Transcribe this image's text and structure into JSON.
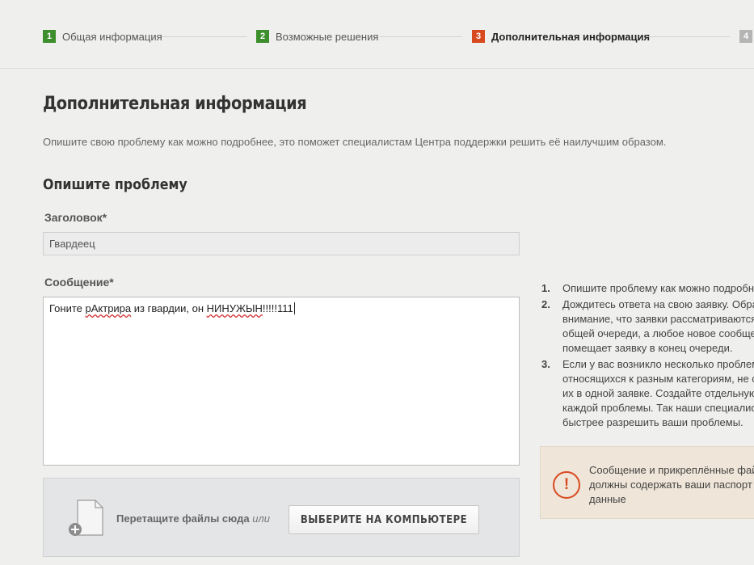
{
  "steps": [
    {
      "num": "1",
      "label": "Общая информация",
      "state": "done"
    },
    {
      "num": "2",
      "label": "Возможные решения",
      "state": "done"
    },
    {
      "num": "3",
      "label": "Дополнительная информация",
      "state": "active"
    },
    {
      "num": "4",
      "label": "",
      "state": "future"
    }
  ],
  "page": {
    "title": "Дополнительная информация",
    "description": "Опишите свою проблему как можно подробнее, это поможет специалистам Центра поддержки решить её наилучшим образом."
  },
  "form": {
    "section_title": "Опишите проблему",
    "subject_label": "Заголовок*",
    "subject_value": "Гвардеец",
    "message_label": "Сообщение*",
    "message_parts": [
      "Гоните ",
      "рАктрира",
      " из гвардии, он ",
      "НИНУЖЫН",
      "!!!!!111"
    ]
  },
  "upload": {
    "drop_text": "Перетащите файлы сюда",
    "or_text": "или",
    "browse_label": "ВЫБЕРИТЕ НА КОМПЬЮТЕРЕ"
  },
  "tips": [
    {
      "num": "1.",
      "lines": [
        "Опишите проблему как можно подробн"
      ]
    },
    {
      "num": "2.",
      "lines": [
        "Дождитесь ответа на свою заявку. Обра",
        "внимание, что заявки рассматриваются",
        "общей очереди, а любое новое сообще",
        "помещает заявку в конец очереди."
      ]
    },
    {
      "num": "3.",
      "lines": [
        "Если у вас возникло несколько проблем",
        "относящихся к разным категориям, не с",
        "их в одной заявке. Создайте отдельную",
        "каждой проблемы. Так наши специалис",
        "быстрее разрешить ваши проблемы."
      ]
    }
  ],
  "warning": {
    "icon": "!",
    "lines": [
      "Сообщение и прикреплённые фай",
      "должны содержать ваши паспорт",
      "данные"
    ]
  },
  "colors": {
    "done": "#3d8e2d",
    "active": "#d8491f",
    "future": "#b5b5b5"
  }
}
